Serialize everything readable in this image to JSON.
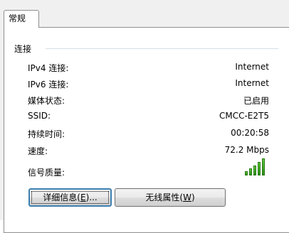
{
  "tabs": [
    "常规"
  ],
  "group_label": "连接",
  "rows": [
    {
      "label": "IPv4 连接:",
      "value": "Internet"
    },
    {
      "label": "IPv6 连接:",
      "value": "Internet"
    },
    {
      "label": "媒体状态:",
      "value": "已启用"
    },
    {
      "label": "SSID:",
      "value": "CMCC-E2T5"
    },
    {
      "label": "持续时间:",
      "value": "00:20:58"
    },
    {
      "label": "速度:",
      "value": "72.2 Mbps"
    }
  ],
  "signal": {
    "label": "信号质量:",
    "bars_filled": 5,
    "bars_total": 5,
    "color": "#3daa22"
  },
  "buttons": {
    "details": {
      "text": "详细信息(",
      "accel": "E",
      "suffix": ")..."
    },
    "wireless": {
      "text": "无线属性(",
      "accel": "W",
      "suffix": ")"
    }
  }
}
